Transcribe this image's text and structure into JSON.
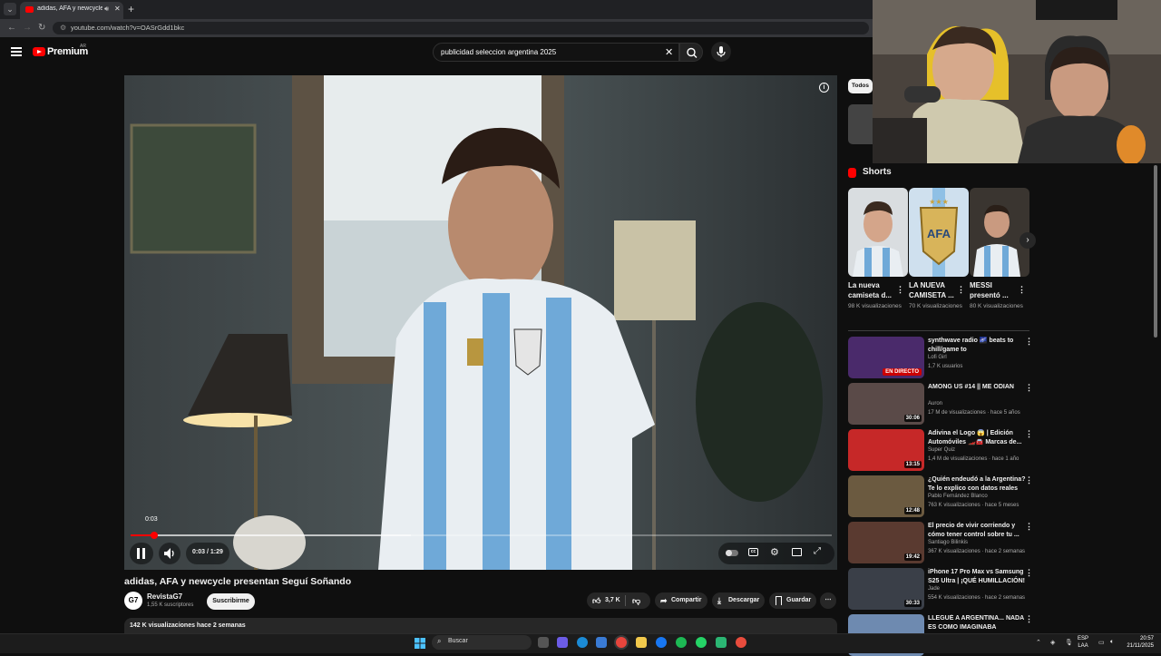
{
  "browser": {
    "tab_title": "adidas, AFA y newcycle pre",
    "url": "youtube.com/watch?v=OASrGdd1bkc"
  },
  "header": {
    "logo_text": "Premium",
    "region": "AR",
    "search_query": "publicidad seleccion argentina 2025"
  },
  "player": {
    "current_time": "0:03",
    "time_display": "0:03 / 1:29",
    "progress_fraction": 0.034,
    "buffered_fraction": 0.4
  },
  "video": {
    "title": "adidas, AFA y newcycle presentan Seguí Soñando",
    "channel": "RevistaG7",
    "channel_avatar_text": "G7",
    "subscribers": "1,55 K suscriptores",
    "subscribe_label": "Suscribirme",
    "likes": "3,7 K",
    "share_label": "Compartir",
    "download_label": "Descargar",
    "save_label": "Guardar",
    "stats": "142 K visualizaciones  hace 2 semanas"
  },
  "sidebar": {
    "chip_all": "Todos",
    "shorts_heading": "Shorts",
    "shorts": [
      {
        "title": "La nueva camiseta d...",
        "views": "98 K visualizaciones"
      },
      {
        "title": "LA NUEVA CAMISETA ...",
        "views": "70 K visualizaciones"
      },
      {
        "title": "MESSI presentó ...",
        "views": "80 K visualizaciones"
      }
    ],
    "videos": [
      {
        "title": "synthwave radio 🌌 beats to chill/game to",
        "channel": "Lofi Girl",
        "meta": "1,7 K usuarios",
        "badge": "EN DIRECTO",
        "thumb_color": "#4a2a6b"
      },
      {
        "title": "AMONG US #14 || ME ODIAN",
        "channel": "Auron",
        "meta": "17 M de visualizaciones · hace 5 años",
        "duration": "30:06",
        "thumb_color": "#5a4a48"
      },
      {
        "title": "Adivina el Logo 😱 | Edición Automóviles 🏎️🚘 Marcas de...",
        "channel": "Super Quiz",
        "meta": "1,4 M de visualizaciones · hace 1 año",
        "duration": "13:15",
        "thumb_color": "#c62828"
      },
      {
        "title": "¿Quién endeudó a la Argentina? Te lo explico con datos reales",
        "channel": "Pablo Fernández Blanco",
        "meta": "763 K visualizaciones · hace 5 meses",
        "duration": "12:48",
        "thumb_color": "#6b5a40"
      },
      {
        "title": "El precio de vivir corriendo y cómo tener control sobre tu ...",
        "channel": "Santiago Bilinkis",
        "meta": "367 K visualizaciones · hace 2 semanas",
        "duration": "19:42",
        "thumb_color": "#5a3a30"
      },
      {
        "title": "iPhone 17 Pro Max vs Samsung S25 Ultra | ¡QUÉ HUMILLACIÓN!",
        "channel": "Jade",
        "meta": "554 K visualizaciones · hace 2 semanas",
        "duration": "30:33",
        "thumb_color": "#3a3f48"
      },
      {
        "title": "LLEGUÉ A ARGENTINA... NADA ES COMO IMAGINABA",
        "channel": "",
        "meta": "",
        "duration": "",
        "thumb_color": "#6e8ab0"
      }
    ]
  },
  "taskbar": {
    "search_label": "Buscar",
    "lang_top": "ESP",
    "lang_bottom": "LAA",
    "time": "20:57",
    "date": "21/11/2025"
  },
  "colors": {
    "accent": "#ff0000",
    "background": "#0f0f0f"
  }
}
